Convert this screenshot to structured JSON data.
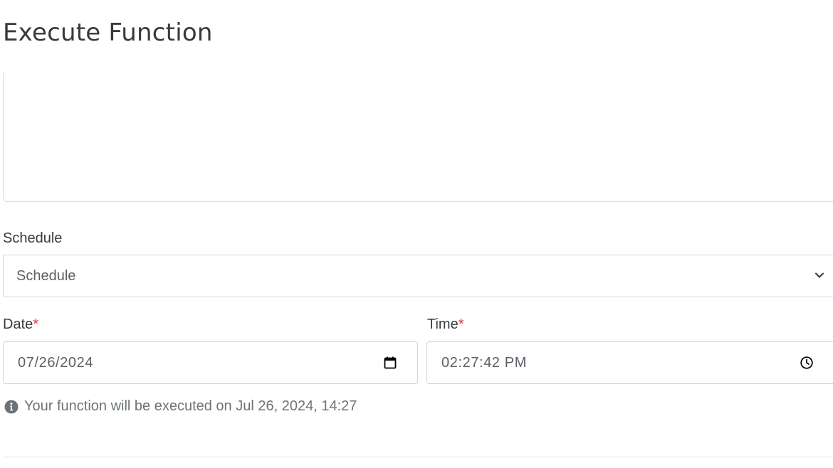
{
  "page": {
    "title": "Execute Function"
  },
  "schedule": {
    "label": "Schedule",
    "selected": "Schedule"
  },
  "date": {
    "label": "Date",
    "required_mark": "*",
    "value": "07/26/2024"
  },
  "time": {
    "label": "Time",
    "required_mark": "*",
    "value": "02:27:42 PM"
  },
  "info": {
    "icon": "info-icon",
    "text": "Your function will be executed on Jul 26, 2024, 14:27"
  },
  "colors": {
    "required": "#dc3545",
    "text": "#373b3d",
    "muted": "#6c7378",
    "border": "#cfd3d6"
  }
}
